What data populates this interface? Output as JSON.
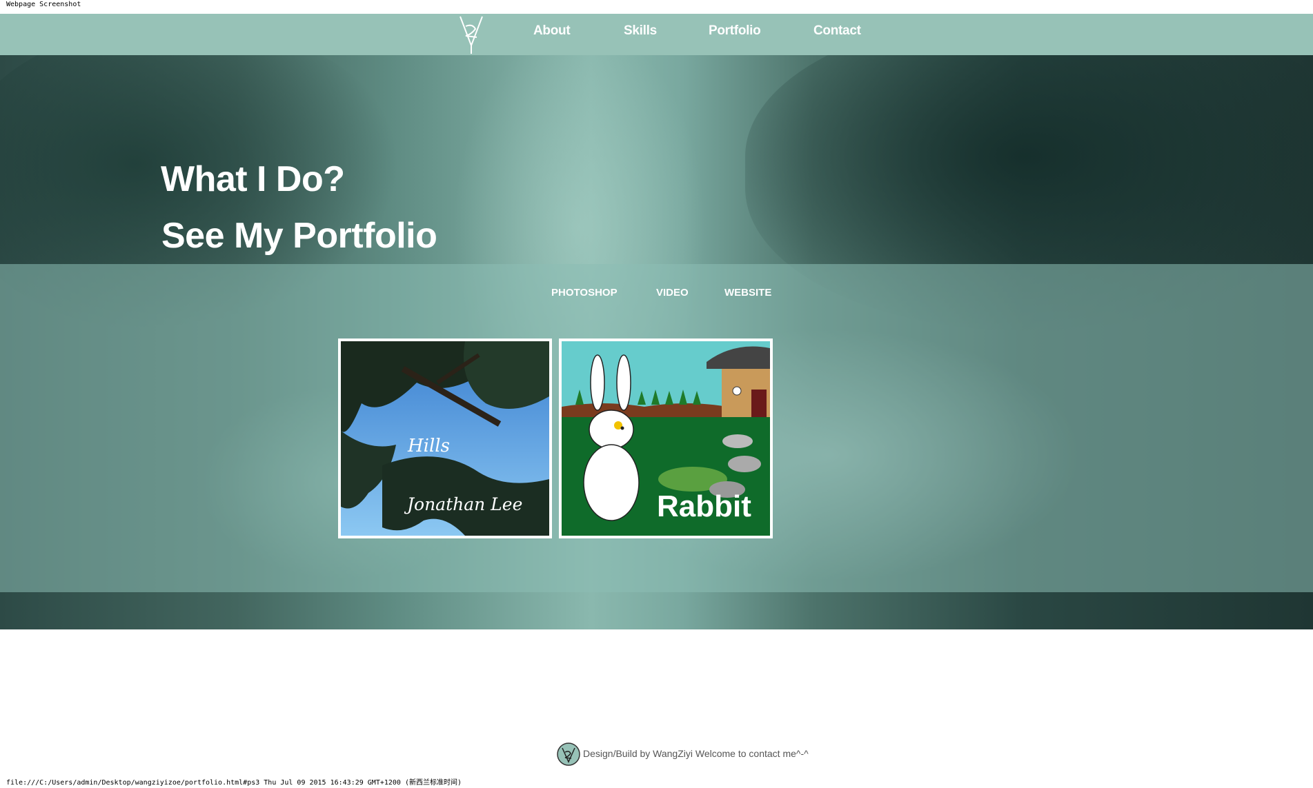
{
  "print_header": "Webpage Screenshot",
  "nav": {
    "logo_icon": "wz-monogram-logo",
    "links": [
      {
        "label": "About"
      },
      {
        "label": "Skills"
      },
      {
        "label": "Portfolio"
      },
      {
        "label": "Contact"
      }
    ]
  },
  "hero": {
    "title": "What I Do?",
    "subtitle": "See My Portfolio"
  },
  "portfolio": {
    "filters": [
      "PHOTOSHOP",
      "VIDEO",
      "WEBSITE"
    ],
    "items": [
      {
        "title": "Hills",
        "author": "Jonathan Lee"
      },
      {
        "title": "Rabbit"
      }
    ]
  },
  "footer": {
    "logo_icon": "wz-monogram-logo",
    "text": "Design/Build by WangZiyi Welcome to contact me^-^"
  },
  "status_bar": "file:///C:/Users/admin/Desktop/wangziyizoe/portfolio.html#ps3 Thu Jul 09 2015 16:43:29 GMT+1200 (新西兰标准时间)",
  "colors": {
    "accent": "#97c2b7",
    "band": "#8cbeb4"
  }
}
